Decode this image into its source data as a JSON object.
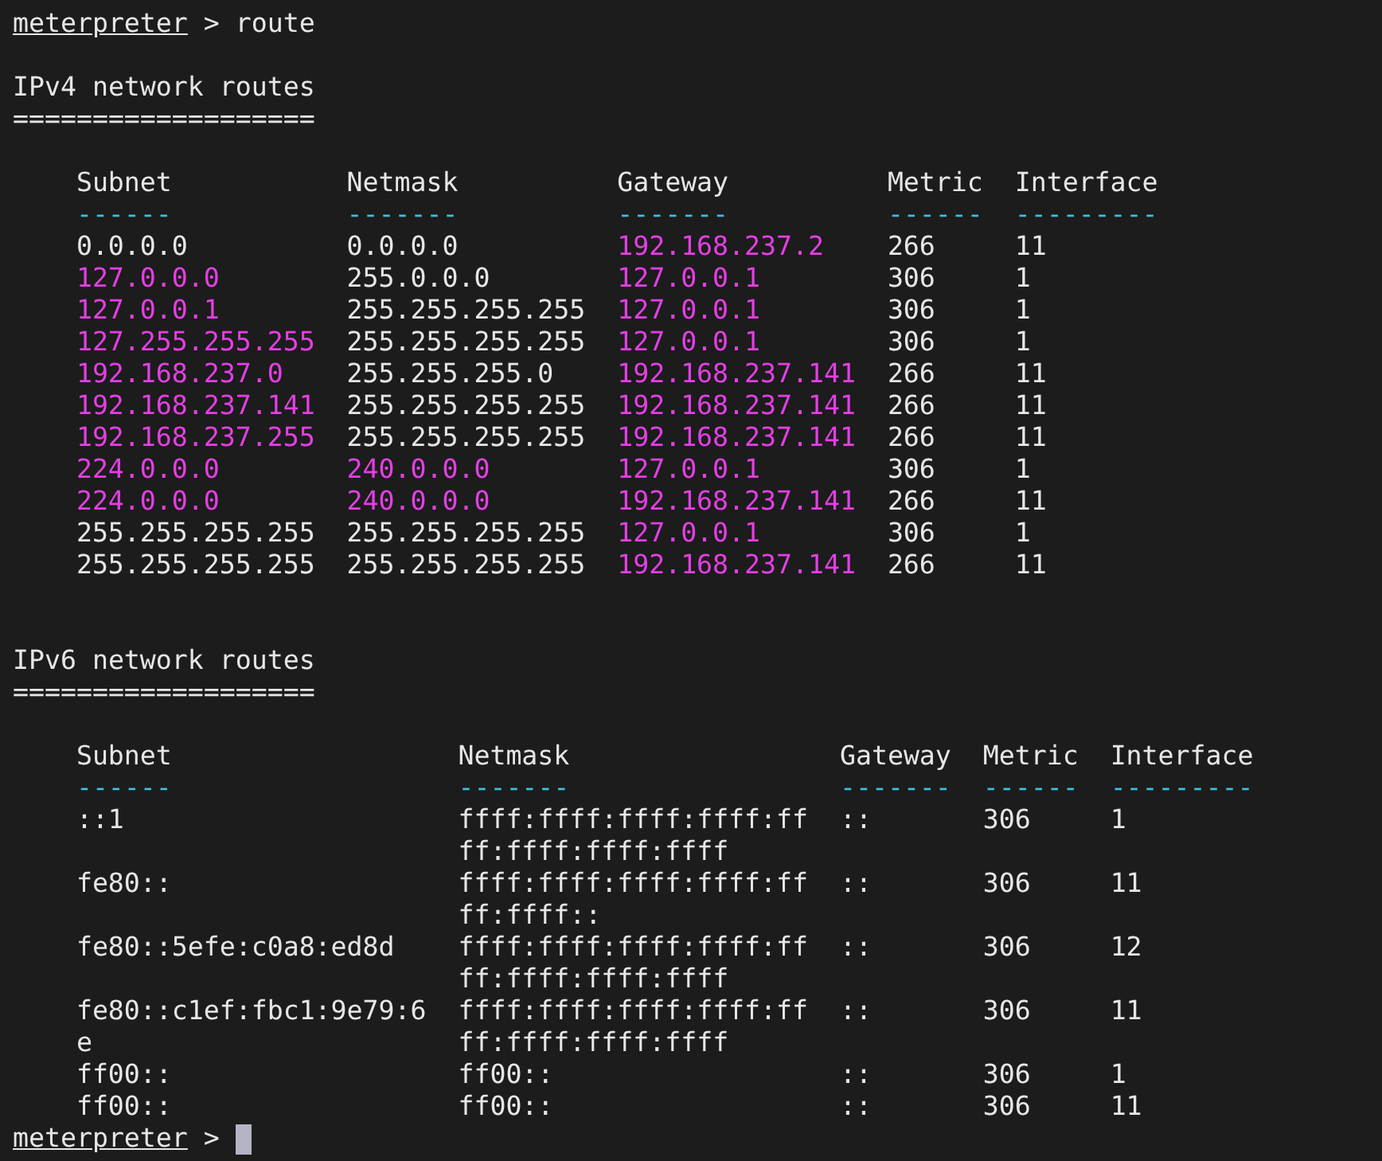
{
  "command_line": {
    "prompt": "meterpreter",
    "separator": ">",
    "command": "route"
  },
  "sections": [
    {
      "title": "IPv4 network routes",
      "rule": "===================",
      "columns": [
        {
          "label": "Subnet",
          "dashes": "------"
        },
        {
          "label": "Netmask",
          "dashes": "-------"
        },
        {
          "label": "Gateway",
          "dashes": "-------"
        },
        {
          "label": "Metric",
          "dashes": "------"
        },
        {
          "label": "Interface",
          "dashes": "---------"
        }
      ],
      "rows": [
        {
          "cells": [
            {
              "text": "0.0.0.0",
              "highlighted": false
            },
            {
              "text": "0.0.0.0",
              "highlighted": false
            },
            {
              "text": "192.168.237.2",
              "highlighted": true
            },
            {
              "text": "266",
              "highlighted": false
            },
            {
              "text": "11",
              "highlighted": false
            }
          ]
        },
        {
          "cells": [
            {
              "text": "127.0.0.0",
              "highlighted": true
            },
            {
              "text": "255.0.0.0",
              "highlighted": false
            },
            {
              "text": "127.0.0.1",
              "highlighted": true
            },
            {
              "text": "306",
              "highlighted": false
            },
            {
              "text": "1",
              "highlighted": false
            }
          ]
        },
        {
          "cells": [
            {
              "text": "127.0.0.1",
              "highlighted": true
            },
            {
              "text": "255.255.255.255",
              "highlighted": false
            },
            {
              "text": "127.0.0.1",
              "highlighted": true
            },
            {
              "text": "306",
              "highlighted": false
            },
            {
              "text": "1",
              "highlighted": false
            }
          ]
        },
        {
          "cells": [
            {
              "text": "127.255.255.255",
              "highlighted": true
            },
            {
              "text": "255.255.255.255",
              "highlighted": false
            },
            {
              "text": "127.0.0.1",
              "highlighted": true
            },
            {
              "text": "306",
              "highlighted": false
            },
            {
              "text": "1",
              "highlighted": false
            }
          ]
        },
        {
          "cells": [
            {
              "text": "192.168.237.0",
              "highlighted": true
            },
            {
              "text": "255.255.255.0",
              "highlighted": false
            },
            {
              "text": "192.168.237.141",
              "highlighted": true
            },
            {
              "text": "266",
              "highlighted": false
            },
            {
              "text": "11",
              "highlighted": false
            }
          ]
        },
        {
          "cells": [
            {
              "text": "192.168.237.141",
              "highlighted": true
            },
            {
              "text": "255.255.255.255",
              "highlighted": false
            },
            {
              "text": "192.168.237.141",
              "highlighted": true
            },
            {
              "text": "266",
              "highlighted": false
            },
            {
              "text": "11",
              "highlighted": false
            }
          ]
        },
        {
          "cells": [
            {
              "text": "192.168.237.255",
              "highlighted": true
            },
            {
              "text": "255.255.255.255",
              "highlighted": false
            },
            {
              "text": "192.168.237.141",
              "highlighted": true
            },
            {
              "text": "266",
              "highlighted": false
            },
            {
              "text": "11",
              "highlighted": false
            }
          ]
        },
        {
          "cells": [
            {
              "text": "224.0.0.0",
              "highlighted": true
            },
            {
              "text": "240.0.0.0",
              "highlighted": true
            },
            {
              "text": "127.0.0.1",
              "highlighted": true
            },
            {
              "text": "306",
              "highlighted": false
            },
            {
              "text": "1",
              "highlighted": false
            }
          ]
        },
        {
          "cells": [
            {
              "text": "224.0.0.0",
              "highlighted": true
            },
            {
              "text": "240.0.0.0",
              "highlighted": true
            },
            {
              "text": "192.168.237.141",
              "highlighted": true
            },
            {
              "text": "266",
              "highlighted": false
            },
            {
              "text": "11",
              "highlighted": false
            }
          ]
        },
        {
          "cells": [
            {
              "text": "255.255.255.255",
              "highlighted": false
            },
            {
              "text": "255.255.255.255",
              "highlighted": false
            },
            {
              "text": "127.0.0.1",
              "highlighted": true
            },
            {
              "text": "306",
              "highlighted": false
            },
            {
              "text": "1",
              "highlighted": false
            }
          ]
        },
        {
          "cells": [
            {
              "text": "255.255.255.255",
              "highlighted": false
            },
            {
              "text": "255.255.255.255",
              "highlighted": false
            },
            {
              "text": "192.168.237.141",
              "highlighted": true
            },
            {
              "text": "266",
              "highlighted": false
            },
            {
              "text": "11",
              "highlighted": false
            }
          ]
        }
      ]
    },
    {
      "title": "IPv6 network routes",
      "rule": "===================",
      "columns": [
        {
          "label": "Subnet",
          "dashes": "------"
        },
        {
          "label": "Netmask",
          "dashes": "-------"
        },
        {
          "label": "Gateway",
          "dashes": "-------"
        },
        {
          "label": "Metric",
          "dashes": "------"
        },
        {
          "label": "Interface",
          "dashes": "---------"
        }
      ],
      "rows": [
        {
          "cells": [
            {
              "text": "::1",
              "highlighted": false
            },
            {
              "text": "ffff:ffff:ffff:ffff:ffff:ffff:ffff:ffff",
              "highlighted": false
            },
            {
              "text": "::",
              "highlighted": false
            },
            {
              "text": "306",
              "highlighted": false
            },
            {
              "text": "1",
              "highlighted": false
            }
          ]
        },
        {
          "cells": [
            {
              "text": "fe80::",
              "highlighted": false
            },
            {
              "text": "ffff:ffff:ffff:ffff:ffff:ffff::",
              "highlighted": false
            },
            {
              "text": "::",
              "highlighted": false
            },
            {
              "text": "306",
              "highlighted": false
            },
            {
              "text": "11",
              "highlighted": false
            }
          ]
        },
        {
          "cells": [
            {
              "text": "fe80::5efe:c0a8:ed8d",
              "highlighted": false
            },
            {
              "text": "ffff:ffff:ffff:ffff:ffff:ffff:ffff:ffff",
              "highlighted": false
            },
            {
              "text": "::",
              "highlighted": false
            },
            {
              "text": "306",
              "highlighted": false
            },
            {
              "text": "12",
              "highlighted": false
            }
          ]
        },
        {
          "cells": [
            {
              "text": "fe80::c1ef:fbc1:9e79:6e",
              "highlighted": false
            },
            {
              "text": "ffff:ffff:ffff:ffff:ffff:ffff:ffff:ffff",
              "highlighted": false
            },
            {
              "text": "::",
              "highlighted": false
            },
            {
              "text": "306",
              "highlighted": false
            },
            {
              "text": "11",
              "highlighted": false
            }
          ]
        },
        {
          "cells": [
            {
              "text": "ff00::",
              "highlighted": false
            },
            {
              "text": "ff00::",
              "highlighted": false
            },
            {
              "text": "::",
              "highlighted": false
            },
            {
              "text": "306",
              "highlighted": false
            },
            {
              "text": "1",
              "highlighted": false
            }
          ]
        },
        {
          "cells": [
            {
              "text": "ff00::",
              "highlighted": false
            },
            {
              "text": "ff00::",
              "highlighted": false
            },
            {
              "text": "::",
              "highlighted": false
            },
            {
              "text": "306",
              "highlighted": false
            },
            {
              "text": "11",
              "highlighted": false
            }
          ]
        }
      ]
    }
  ],
  "final_prompt": {
    "prompt": "meterpreter",
    "separator": ">",
    "cursor": true
  }
}
